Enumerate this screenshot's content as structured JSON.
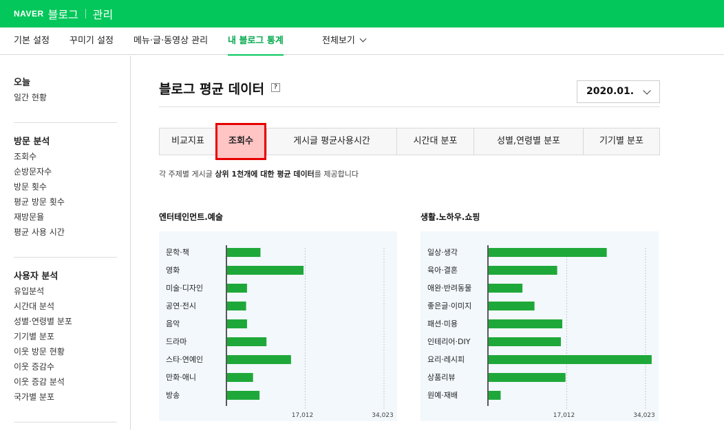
{
  "header": {
    "logo": "NAVER",
    "brand": "블로그",
    "admin": "관리"
  },
  "menu": {
    "items": [
      "기본 설정",
      "꾸미기 설정",
      "메뉴·글·동영상 관리",
      "내 블로그 통계"
    ],
    "dropdown": "전체보기"
  },
  "sidebar": {
    "sections": [
      {
        "title": "오늘",
        "items": [
          "일간 현황"
        ]
      },
      {
        "title": "방문 분석",
        "items": [
          "조회수",
          "순방문자수",
          "방문 횟수",
          "평균 방문 횟수",
          "재방문율",
          "평균 사용 시간"
        ]
      },
      {
        "title": "사용자 분석",
        "items": [
          "유입분석",
          "시간대 분석",
          "성별·연령별 분포",
          "기기별 분포",
          "이웃 방문 현황",
          "이웃 증감수",
          "이웃 증감 분석",
          "국가별 분포"
        ]
      }
    ]
  },
  "page": {
    "title": "블로그 평균 데이터",
    "help": "?",
    "date": "2020.01.",
    "tabs": [
      "비교지표",
      "조회수",
      "게시글 평균사용시간",
      "시간대 분포",
      "성별,연령별 분포",
      "기기별 분포"
    ],
    "selected_tab": "조회수",
    "desc_pre": "각 주제별 게시글 ",
    "desc_bold": "상위 1천개에 대한 평균 데이터",
    "desc_post": "를 제공합니다"
  },
  "colors": {
    "brand": "#03c75a",
    "bar": "#1fa83a",
    "highlight_border": "#e60000",
    "highlight_fill": "#ffc4c4"
  },
  "chart_data": [
    {
      "type": "bar",
      "orientation": "horizontal",
      "title": "엔터테인먼트.예술",
      "categories": [
        "문학·책",
        "영화",
        "미술·디자인",
        "공연·전시",
        "음악",
        "드라마",
        "스타·연예인",
        "만화·애니",
        "방송"
      ],
      "values": [
        7200,
        16500,
        4300,
        4100,
        4300,
        8500,
        13800,
        5600,
        7000
      ],
      "xlim": [
        0,
        34023
      ],
      "tick_labels": [
        "17,012",
        "34,023"
      ],
      "tick_values": [
        17012,
        34023
      ]
    },
    {
      "type": "bar",
      "orientation": "horizontal",
      "title": "생활.노하우.쇼핑",
      "categories": [
        "일상·생각",
        "육아·결혼",
        "애완·반려동물",
        "좋은글·이미지",
        "패션·미용",
        "인테리어·DIY",
        "요리·레시피",
        "상품리뷰",
        "원예·재배"
      ],
      "values": [
        25500,
        14800,
        7300,
        9900,
        15900,
        15600,
        35200,
        16600,
        2600
      ],
      "xlim": [
        0,
        34023
      ],
      "tick_labels": [
        "17,012",
        "34,023"
      ],
      "tick_values": [
        17012,
        34023
      ]
    }
  ]
}
